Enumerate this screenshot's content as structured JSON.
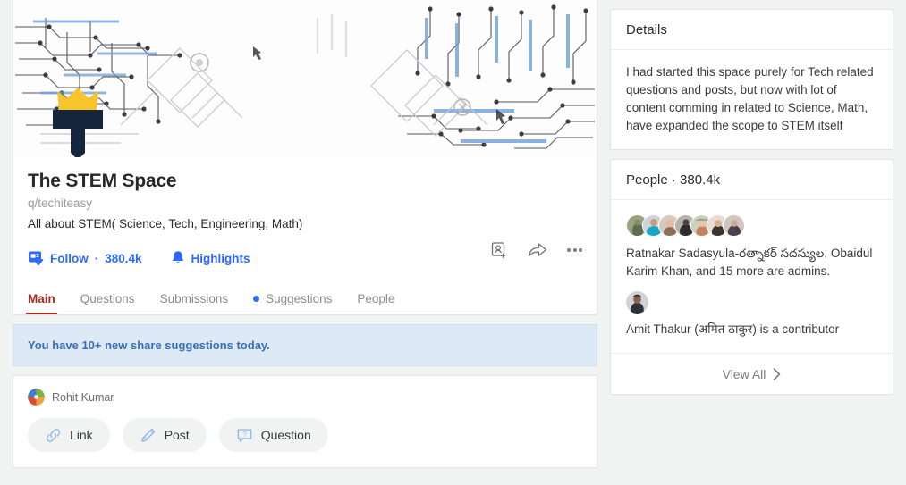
{
  "space": {
    "title": "The STEM Space",
    "handle": "q/techiteasy",
    "description": "All about STEM( Science, Tech, Engineering, Math)",
    "follow_label": "Follow",
    "follow_separator": "·",
    "follow_count": "380.4k",
    "highlights_label": "Highlights",
    "icons": {
      "follow": "follow-square-check-icon",
      "highlights": "bell-icon",
      "invite": "add-person-icon",
      "share": "share-arrow-icon",
      "more": "more-options-icon"
    },
    "banner": {
      "image": "circuit-board-banner",
      "logo": "crowned-t-logo"
    }
  },
  "tabs": [
    {
      "label": "Main",
      "active": true,
      "dot": false
    },
    {
      "label": "Questions",
      "active": false,
      "dot": false
    },
    {
      "label": "Submissions",
      "active": false,
      "dot": false
    },
    {
      "label": "Suggestions",
      "active": false,
      "dot": true
    },
    {
      "label": "People",
      "active": false,
      "dot": false
    }
  ],
  "suggestion_bar": {
    "text": "You have 10+ new share suggestions today."
  },
  "composer": {
    "user_name": "Rohit Kumar",
    "avatar": "pinwheel-avatar",
    "actions": [
      {
        "label": "Link",
        "icon": "link-icon"
      },
      {
        "label": "Post",
        "icon": "pencil-icon"
      },
      {
        "label": "Question",
        "icon": "question-bubble-icon"
      }
    ]
  },
  "details": {
    "heading": "Details",
    "body": "I had started this space purely for Tech related questions and posts, but now with lot of content comming in related to Science, Math, have expanded the scope to STEM itself"
  },
  "people": {
    "heading": "People · 380.4k",
    "admins_line": "Ratnakar Sadasyula-రత్నాకర్ సదస్యుల, Obaidul Karim Khan, and 15 more are admins.",
    "contributor_line": "Amit Thakur (अमित ठाकुर) is a contributor",
    "view_all_label": "View All",
    "avatar_count": 7
  },
  "colors": {
    "accent_blue": "#2e69ff",
    "active_tab": "#a32b17",
    "page_bg": "#f1f2f2",
    "card_bg": "#ffffff",
    "suggestion_bg": "#ddeaf6",
    "crown_gold": "#f7c52b"
  }
}
